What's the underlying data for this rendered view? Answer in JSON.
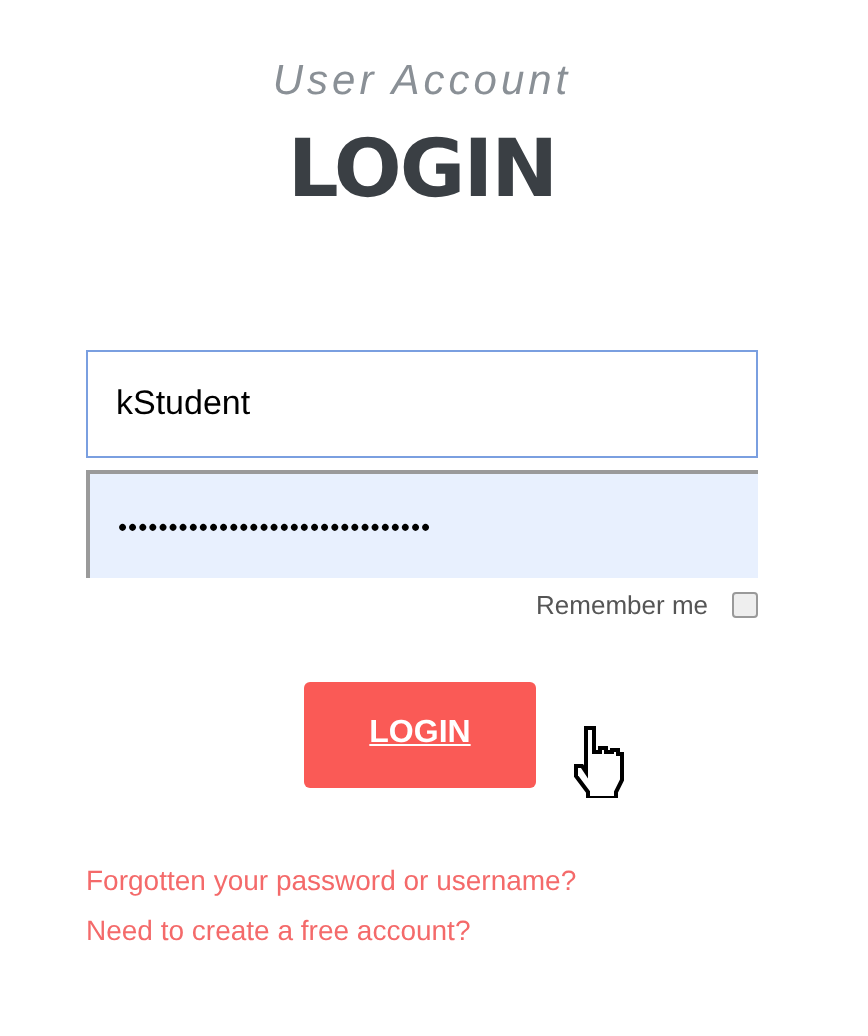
{
  "header": {
    "subtitle": "User Account",
    "title": "LOGIN"
  },
  "username": {
    "value": "kStudent"
  },
  "password": {
    "value": "•••••••••••••••••••••••••••••••"
  },
  "remember": {
    "label": "Remember me",
    "checked": false
  },
  "login_button": {
    "label": "LOGIN"
  },
  "links": [
    {
      "label": "Forgotten your password or username?"
    },
    {
      "label": "Need to create a free account?"
    }
  ]
}
